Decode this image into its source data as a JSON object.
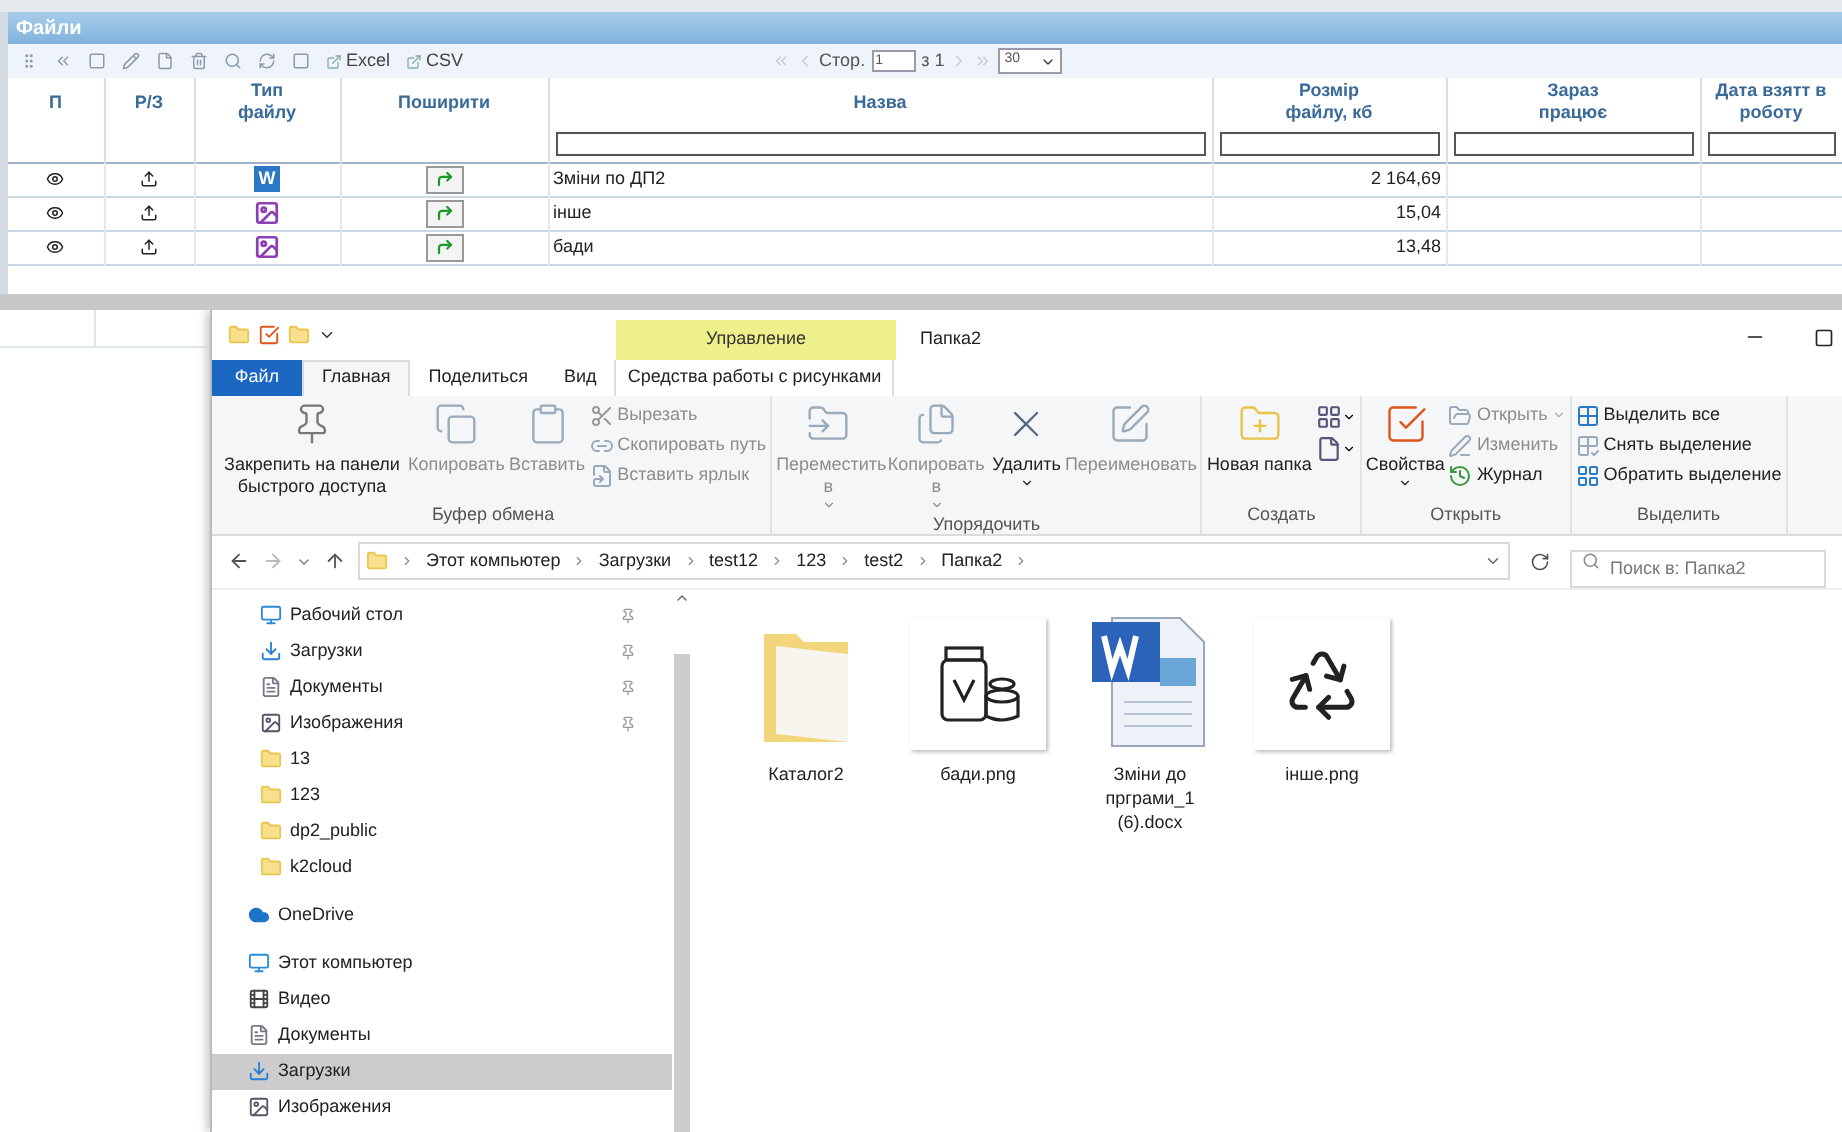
{
  "web_panel": {
    "title": "Файли",
    "toolbar": {
      "exports": [
        "Excel",
        "CSV"
      ],
      "pager": {
        "page_label": "Стор.",
        "page": "1",
        "total": "з 1",
        "page_size": "30"
      }
    },
    "columns": [
      {
        "label": "П",
        "filter": false
      },
      {
        "label": "Р/З",
        "filter": false
      },
      {
        "label": "Тип файлу",
        "filter": false
      },
      {
        "label": "Поширити",
        "filter": false
      },
      {
        "label": "Назва",
        "filter": true
      },
      {
        "label": "Розмір файлу, кб",
        "filter": true
      },
      {
        "label": "Зараз працює",
        "filter": true
      },
      {
        "label": "Дата взятт в роботу",
        "filter": true
      }
    ],
    "rows": [
      {
        "kind": "word",
        "badge": "W",
        "name": "Зміни по ДП2",
        "size": "2 164,69"
      },
      {
        "kind": "image",
        "name": "інше",
        "size": "15,04"
      },
      {
        "kind": "image",
        "name": "бади",
        "size": "13,48"
      }
    ]
  },
  "explorer": {
    "title": "Папка2",
    "contextual_group": "Управление",
    "tabs": [
      {
        "label": "Файл",
        "kind": "file",
        "selected": false
      },
      {
        "label": "Главная",
        "kind": "tab",
        "selected": true
      },
      {
        "label": "Поделиться",
        "kind": "tab",
        "selected": false
      },
      {
        "label": "Вид",
        "kind": "tab",
        "selected": false
      },
      {
        "label": "Средства работы с рисунками",
        "kind": "contextual",
        "selected": false
      }
    ],
    "ribbon": [
      {
        "label": "Буфер обмена",
        "items": [
          {
            "label": "Закрепить на панели быстрого доступа",
            "kind": "large",
            "disabled": false,
            "menu": false
          },
          {
            "label": "Копировать",
            "kind": "large",
            "disabled": true,
            "menu": false
          },
          {
            "label": "Вставить",
            "kind": "large",
            "disabled": true,
            "menu": false
          },
          {
            "label": "Вырезать",
            "kind": "small",
            "disabled": true,
            "menu": false
          },
          {
            "label": "Скопировать путь",
            "kind": "small",
            "disabled": true,
            "menu": false
          },
          {
            "label": "Вставить ярлык",
            "kind": "small",
            "disabled": true,
            "menu": false
          }
        ]
      },
      {
        "label": "Упорядочить",
        "items": [
          {
            "label": "Переместить в",
            "kind": "large",
            "disabled": true,
            "menu": true
          },
          {
            "label": "Копировать в",
            "kind": "large",
            "disabled": true,
            "menu": true
          },
          {
            "label": "Удалить",
            "kind": "large",
            "disabled": false,
            "menu": true
          },
          {
            "label": "Переименовать",
            "kind": "large",
            "disabled": true,
            "menu": false
          }
        ]
      },
      {
        "label": "Создать",
        "items": [
          {
            "label": "Новая папка",
            "kind": "large",
            "disabled": false,
            "menu": false
          },
          {
            "kind": "icon",
            "disabled": false,
            "menu": true
          },
          {
            "kind": "icon",
            "disabled": false,
            "menu": true
          }
        ]
      },
      {
        "label": "Открыть",
        "items": [
          {
            "label": "Свойства",
            "kind": "large",
            "disabled": false,
            "menu": true
          },
          {
            "label": "Открыть",
            "kind": "small",
            "disabled": true,
            "menu": true
          },
          {
            "label": "Изменить",
            "kind": "small",
            "disabled": true,
            "menu": false
          },
          {
            "label": "Журнал",
            "kind": "small",
            "disabled": false,
            "menu": false
          }
        ]
      },
      {
        "label": "Выделить",
        "items": [
          {
            "label": "Выделить все",
            "kind": "small",
            "disabled": false,
            "menu": false
          },
          {
            "label": "Снять выделение",
            "kind": "small",
            "disabled": false,
            "menu": false
          },
          {
            "label": "Обратить выделение",
            "kind": "small",
            "disabled": false,
            "menu": false
          }
        ]
      }
    ],
    "address": [
      "Этот компьютер",
      "Загрузки",
      "test12",
      "123",
      "test2",
      "Папка2"
    ],
    "search": {
      "placeholder": "Поиск в: Папка2"
    },
    "nav": [
      {
        "label": "Рабочий стол",
        "kind": "desktop",
        "pinned": true,
        "selected": false
      },
      {
        "label": "Загрузки",
        "kind": "downloads",
        "pinned": true,
        "selected": false
      },
      {
        "label": "Документы",
        "kind": "documents",
        "pinned": true,
        "selected": false
      },
      {
        "label": "Изображения",
        "kind": "pictures",
        "pinned": true,
        "selected": false
      },
      {
        "label": "13",
        "kind": "folder",
        "pinned": false,
        "selected": false
      },
      {
        "label": "123",
        "kind": "folder",
        "pinned": false,
        "selected": false
      },
      {
        "label": "dp2_public",
        "kind": "folder",
        "pinned": false,
        "selected": false
      },
      {
        "label": "k2cloud",
        "kind": "folder",
        "pinned": false,
        "selected": false
      },
      {
        "label": "OneDrive",
        "kind": "onedrive",
        "pinned": false,
        "selected": false
      },
      {
        "label": "Этот компьютер",
        "kind": "computer",
        "pinned": false,
        "selected": false,
        "children": [
          {
            "label": "Видео",
            "kind": "video",
            "pinned": false,
            "selected": false
          },
          {
            "label": "Документы",
            "kind": "documents",
            "pinned": false,
            "selected": false
          },
          {
            "label": "Загрузки",
            "kind": "downloads",
            "pinned": false,
            "selected": true
          },
          {
            "label": "Изображения",
            "kind": "pictures",
            "pinned": false,
            "selected": false
          }
        ]
      }
    ],
    "files": [
      {
        "name": "Каталог2",
        "kind": "folder"
      },
      {
        "name": "бади.png",
        "kind": "pills"
      },
      {
        "name": "Зміни до прграми_1 (6).docx",
        "kind": "word"
      },
      {
        "name": "інше.png",
        "kind": "recycle"
      }
    ]
  }
}
